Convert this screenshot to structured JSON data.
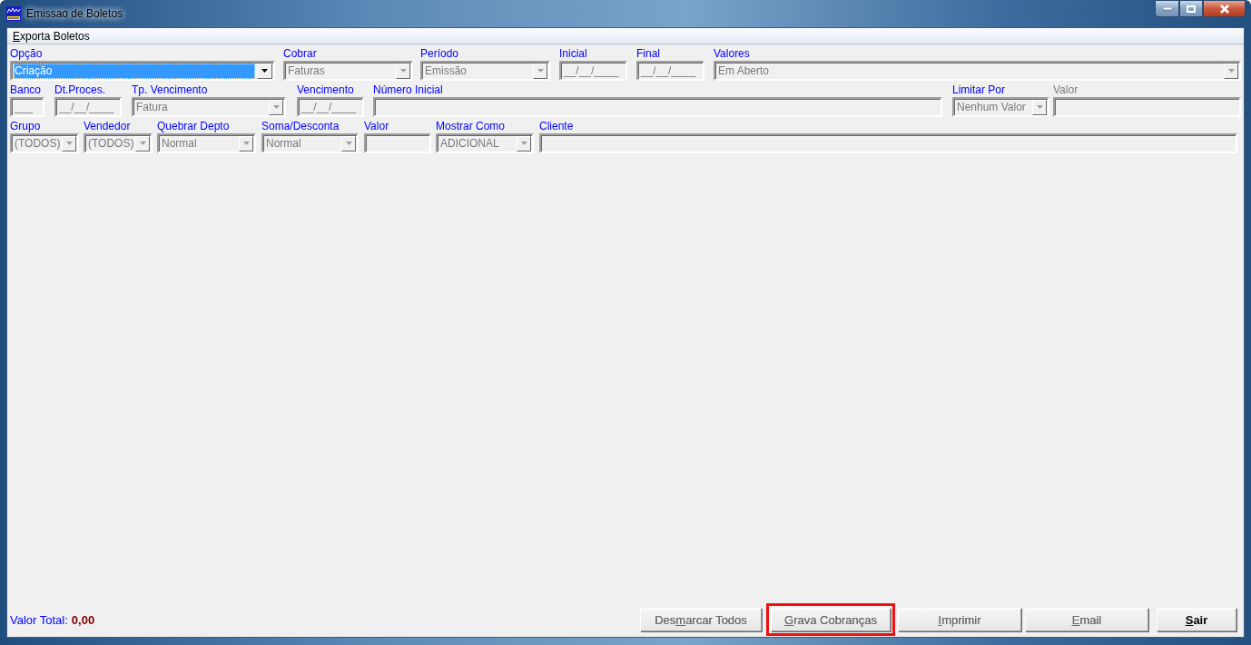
{
  "window": {
    "title": "Emissao de Boletos"
  },
  "menu": [
    {
      "accesskey": "E",
      "label_after": "xporta Boletos"
    }
  ],
  "form_rows": [
    [
      {
        "label": "Opção",
        "kind": "combo",
        "value": "Criação",
        "enabled": true,
        "label_dimmed": false
      },
      {
        "label": "Cobrar",
        "kind": "combo",
        "value": "Faturas",
        "enabled": false,
        "label_dimmed": false
      },
      {
        "label": "Período",
        "kind": "combo",
        "value": "Emissão",
        "enabled": false,
        "label_dimmed": false
      },
      {
        "label": "Inicial",
        "kind": "text",
        "value": "__/__/____",
        "enabled": false,
        "label_dimmed": false
      },
      {
        "label": "Final",
        "kind": "text",
        "value": "__/__/____",
        "enabled": false,
        "label_dimmed": false
      },
      {
        "label": "Valores",
        "kind": "combo",
        "value": "Em Aberto",
        "enabled": false,
        "label_dimmed": false
      }
    ],
    [
      {
        "label": "Banco",
        "kind": "text",
        "value": "___",
        "enabled": false,
        "label_dimmed": false
      },
      {
        "label": "Dt.Proces.",
        "kind": "text",
        "value": "__/__/____",
        "enabled": false,
        "label_dimmed": false
      },
      {
        "label": "Tp. Vencimento",
        "kind": "combo",
        "value": "Fatura",
        "enabled": false,
        "label_dimmed": false
      },
      {
        "label": "Vencimento",
        "kind": "text",
        "value": "__/__/____",
        "enabled": false,
        "label_dimmed": false
      },
      {
        "label": "Número Inicial",
        "kind": "text",
        "enabled": false,
        "label_dimmed": false
      },
      {
        "label": "Limitar Por",
        "kind": "combo",
        "value": "Nenhum Valor",
        "enabled": false,
        "label_dimmed": false
      },
      {
        "label": "Valor",
        "kind": "text",
        "enabled": false,
        "label_dimmed": true
      }
    ],
    [
      {
        "label": "Grupo",
        "kind": "combo",
        "value": "(TODOS)",
        "enabled": false,
        "label_dimmed": false
      },
      {
        "label": "Vendedor",
        "kind": "combo",
        "value": "(TODOS)",
        "enabled": false,
        "label_dimmed": false
      },
      {
        "label": "Quebrar Depto",
        "kind": "combo",
        "value": "Normal",
        "enabled": false,
        "label_dimmed": false
      },
      {
        "label": "Soma/Desconta",
        "kind": "combo",
        "value": "Normal",
        "enabled": false,
        "label_dimmed": false
      },
      {
        "label": "Valor",
        "kind": "text",
        "enabled": false,
        "label_dimmed": false
      },
      {
        "label": "Mostrar Como",
        "kind": "combo",
        "value": "ADICIONAL",
        "enabled": false,
        "label_dimmed": false
      },
      {
        "label": "Cliente",
        "kind": "text",
        "enabled": false,
        "label_dimmed": false
      }
    ]
  ],
  "total": {
    "label": "Valor Total:",
    "value": "0,00"
  },
  "buttons": [
    {
      "label_before": "Des",
      "accesskey": "m",
      "label_after": "arcar Todos",
      "disabled": true,
      "highlighted": false,
      "bold": false
    },
    {
      "accesskey": "G",
      "label_after": "rava Cobranças",
      "disabled": true,
      "highlighted": true,
      "bold": false
    },
    {
      "accesskey": "I",
      "label_after": "mprimir",
      "disabled": true,
      "highlighted": false,
      "bold": false
    },
    {
      "accesskey": "E",
      "label_after": "mail",
      "disabled": true,
      "highlighted": false,
      "bold": false
    },
    {
      "accesskey": "S",
      "label_after": "air",
      "disabled": false,
      "highlighted": false,
      "bold": true
    }
  ]
}
